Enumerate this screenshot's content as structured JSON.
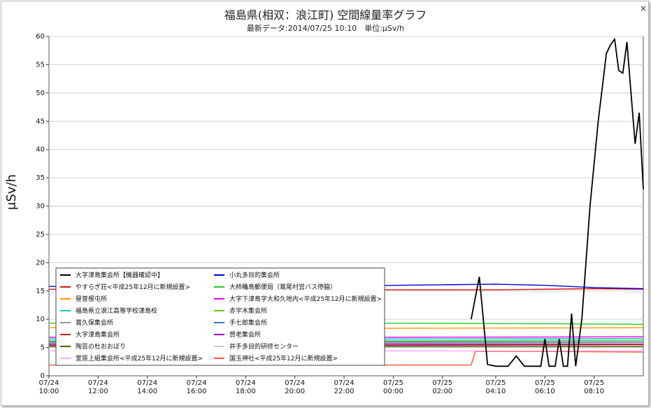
{
  "window": {
    "close_label": "×"
  },
  "chart_data": {
    "type": "line",
    "title": "福島県(相双：浪江町) 空間線量率グラフ",
    "subtitle": "最新データ:2014/07/25 10:10　単位:μSv/h",
    "ylabel": "μSv/h",
    "ylim": [
      0,
      60
    ],
    "yticks": [
      0,
      5,
      10,
      15,
      20,
      25,
      30,
      35,
      40,
      45,
      50,
      55,
      60
    ],
    "xlim": [
      "2014-07-24 10:00",
      "2014-07-25 10:10"
    ],
    "xticks": [
      {
        "date": "07/24",
        "time": "10:00",
        "t": "2014-07-24 10:00"
      },
      {
        "date": "07/24",
        "time": "12:00",
        "t": "2014-07-24 12:00"
      },
      {
        "date": "07/24",
        "time": "14:00",
        "t": "2014-07-24 14:00"
      },
      {
        "date": "07/24",
        "time": "16:00",
        "t": "2014-07-24 16:00"
      },
      {
        "date": "07/24",
        "time": "18:00",
        "t": "2014-07-24 18:00"
      },
      {
        "date": "07/24",
        "time": "20:00",
        "t": "2014-07-24 20:00"
      },
      {
        "date": "07/24",
        "time": "22:00",
        "t": "2014-07-24 22:00"
      },
      {
        "date": "07/25",
        "time": "00:00",
        "t": "2014-07-25 00:00"
      },
      {
        "date": "07/25",
        "time": "02:00",
        "t": "2014-07-25 02:00"
      },
      {
        "date": "07/25",
        "time": "04:10",
        "t": "2014-07-25 04:10"
      },
      {
        "date": "07/25",
        "time": "06:10",
        "t": "2014-07-25 06:10"
      },
      {
        "date": "07/25",
        "time": "08:10",
        "t": "2014-07-25 08:10"
      }
    ],
    "grid": "horizontal",
    "legend_position": "bottom-left",
    "series": [
      {
        "name": "大字津島集会所【機器確認中】",
        "color": "#000000",
        "points": [
          [
            "2014-07-25 03:10",
            10
          ],
          [
            "2014-07-25 03:30",
            17.5
          ],
          [
            "2014-07-25 03:50",
            2
          ],
          [
            "2014-07-25 04:10",
            1.7
          ],
          [
            "2014-07-25 04:40",
            1.7
          ],
          [
            "2014-07-25 05:00",
            3.5
          ],
          [
            "2014-07-25 05:20",
            1.7
          ],
          [
            "2014-07-25 05:50",
            1.7
          ],
          [
            "2014-07-25 06:00",
            1.7
          ],
          [
            "2014-07-25 06:10",
            6.5
          ],
          [
            "2014-07-25 06:20",
            1.7
          ],
          [
            "2014-07-25 06:35",
            1.7
          ],
          [
            "2014-07-25 06:45",
            6.5
          ],
          [
            "2014-07-25 06:55",
            1.7
          ],
          [
            "2014-07-25 07:05",
            1.7
          ],
          [
            "2014-07-25 07:15",
            11
          ],
          [
            "2014-07-25 07:25",
            1.7
          ],
          [
            "2014-07-25 07:40",
            10
          ],
          [
            "2014-07-25 08:00",
            30
          ],
          [
            "2014-07-25 08:20",
            45
          ],
          [
            "2014-07-25 08:40",
            57
          ],
          [
            "2014-07-25 08:50",
            58.5
          ],
          [
            "2014-07-25 09:00",
            59.5
          ],
          [
            "2014-07-25 09:10",
            54
          ],
          [
            "2014-07-25 09:20",
            53.5
          ],
          [
            "2014-07-25 09:30",
            59
          ],
          [
            "2014-07-25 09:40",
            50
          ],
          [
            "2014-07-25 09:50",
            41
          ],
          [
            "2014-07-25 10:00",
            46.5
          ],
          [
            "2014-07-25 10:10",
            33
          ]
        ]
      },
      {
        "name": "小丸多目的集会所",
        "color": "#0000dd",
        "points": [
          [
            "2014-07-24 10:00",
            15.8
          ],
          [
            "2014-07-24 16:00",
            15.7
          ],
          [
            "2014-07-24 22:00",
            15.8
          ],
          [
            "2014-07-25 00:00",
            16.0
          ],
          [
            "2014-07-25 02:00",
            16.1
          ],
          [
            "2014-07-25 04:10",
            16.2
          ],
          [
            "2014-07-25 06:10",
            16.0
          ],
          [
            "2014-07-25 08:10",
            15.6
          ],
          [
            "2014-07-25 10:10",
            15.4
          ]
        ]
      },
      {
        "name": "やすらぎ荘<平成25年12月に新規設置>",
        "color": "#dd1111",
        "points": [
          [
            "2014-07-24 10:00",
            15.3
          ],
          [
            "2014-07-24 16:00",
            15.2
          ],
          [
            "2014-07-24 22:00",
            15.2
          ],
          [
            "2014-07-25 04:10",
            15.2
          ],
          [
            "2014-07-25 08:10",
            15.4
          ],
          [
            "2014-07-25 10:10",
            15.3
          ]
        ]
      },
      {
        "name": "大柿穐島郵便局（葛尾村営バス停脇）",
        "color": "#22cc22",
        "points": [
          [
            "2014-07-24 10:00",
            9.3
          ],
          [
            "2014-07-24 16:00",
            9.2
          ],
          [
            "2014-07-25 00:00",
            9.3
          ],
          [
            "2014-07-25 06:10",
            9.2
          ],
          [
            "2014-07-25 10:10",
            9.1
          ]
        ]
      },
      {
        "name": "昼曽根屯所",
        "color": "#ff9900",
        "points": [
          [
            "2014-07-24 10:00",
            8.5
          ],
          [
            "2014-07-25 00:00",
            8.4
          ],
          [
            "2014-07-25 10:10",
            8.5
          ]
        ]
      },
      {
        "name": "大字下津島字大和久地内<平成25年12月に新規設置>",
        "color": "#ee00ee",
        "points": [
          [
            "2014-07-24 10:00",
            6.8
          ],
          [
            "2014-07-25 00:00",
            6.8
          ],
          [
            "2014-07-25 10:10",
            6.9
          ]
        ]
      },
      {
        "name": "福島県立浪江高等学校津島校",
        "color": "#00cccc",
        "points": [
          [
            "2014-07-24 10:00",
            6.5
          ],
          [
            "2014-07-25 00:00",
            6.5
          ],
          [
            "2014-07-25 10:10",
            6.6
          ]
        ]
      },
      {
        "name": "赤宇木集会所",
        "color": "#66cc00",
        "points": [
          [
            "2014-07-24 10:00",
            6.2
          ],
          [
            "2014-07-25 00:00",
            6.2
          ],
          [
            "2014-07-25 10:10",
            6.3
          ]
        ]
      },
      {
        "name": "葛久保集会所",
        "color": "#999999",
        "points": [
          [
            "2014-07-24 10:00",
            5.8
          ],
          [
            "2014-07-25 00:00",
            5.8
          ],
          [
            "2014-07-25 10:10",
            5.9
          ]
        ]
      },
      {
        "name": "手七郎集会所",
        "color": "#3377cc",
        "points": [
          [
            "2014-07-24 10:00",
            6.0
          ],
          [
            "2014-07-25 00:00",
            6.0
          ],
          [
            "2014-07-25 10:10",
            6.0
          ]
        ]
      },
      {
        "name": "大字津島集会所",
        "color": "#cc2222",
        "points": [
          [
            "2014-07-24 10:00",
            5.4
          ],
          [
            "2014-07-25 00:00",
            5.4
          ],
          [
            "2014-07-25 10:10",
            5.5
          ]
        ]
      },
      {
        "name": "賀老集会所",
        "color": "#9900cc",
        "points": [
          [
            "2014-07-24 10:00",
            5.6
          ],
          [
            "2014-07-25 00:00",
            5.6
          ],
          [
            "2014-07-25 10:10",
            5.6
          ]
        ]
      },
      {
        "name": "陶芸の杜おおぼり",
        "color": "#446600",
        "points": [
          [
            "2014-07-24 10:00",
            5.2
          ],
          [
            "2014-07-25 00:00",
            5.2
          ],
          [
            "2014-07-25 10:10",
            5.2
          ]
        ]
      },
      {
        "name": "井手多目的研修センター",
        "color": "#cccccc",
        "points": [
          [
            "2014-07-24 10:00",
            5.0
          ],
          [
            "2014-07-25 00:00",
            5.0
          ],
          [
            "2014-07-25 10:10",
            5.0
          ]
        ]
      },
      {
        "name": "室原上組集会所<平成25年12月に新規設置>",
        "color": "#ffaaff",
        "points": [
          [
            "2014-07-24 10:00",
            4.4
          ],
          [
            "2014-07-25 00:00",
            4.4
          ],
          [
            "2014-07-25 10:10",
            4.4
          ]
        ]
      },
      {
        "name": "国玉神社<平成25年12月に新規設置>",
        "color": "#ff5533",
        "points": [
          [
            "2014-07-24 10:00",
            1.9
          ],
          [
            "2014-07-25 02:00",
            1.9
          ],
          [
            "2014-07-25 03:10",
            1.9
          ],
          [
            "2014-07-25 03:20",
            4.3
          ],
          [
            "2014-07-25 06:10",
            4.3
          ],
          [
            "2014-07-25 10:10",
            4.2
          ]
        ]
      }
    ]
  }
}
